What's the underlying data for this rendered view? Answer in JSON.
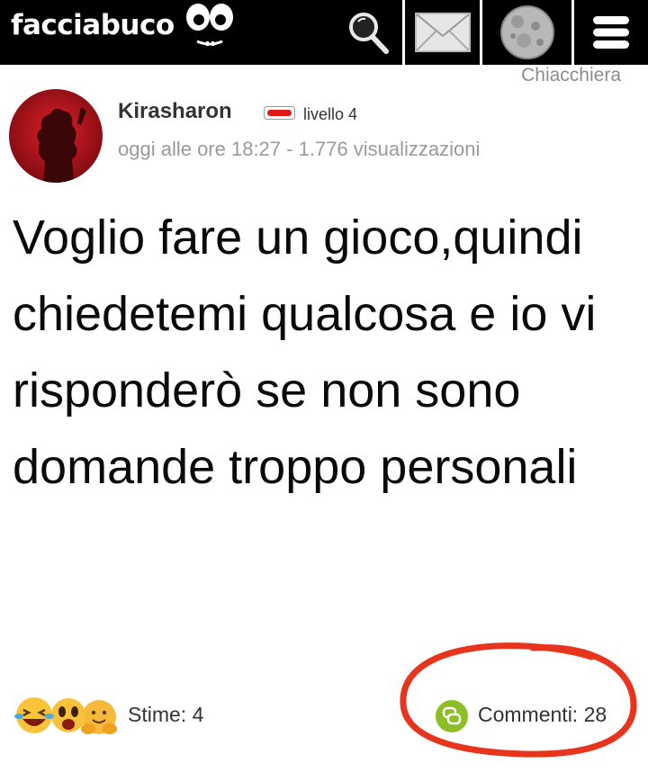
{
  "header": {
    "logo_text": "facciabuco",
    "nav": [
      {
        "name": "search",
        "icon": "search-icon"
      },
      {
        "name": "messages",
        "icon": "envelope-icon"
      },
      {
        "name": "profile",
        "icon": "moon-avatar-icon"
      },
      {
        "name": "menu",
        "icon": "hamburger-menu-icon"
      }
    ]
  },
  "section_tag": "Chiacchiera",
  "post": {
    "username": "Kirasharon",
    "level": "livello 4",
    "meta": "oggi alle ore 18:27 - 1.776 visualizzazioni",
    "body": "Voglio fare un gioco,quindi chiedetemi qualcosa e io vi risponderò se non sono domande troppo personali"
  },
  "footer": {
    "reactions": [
      "laughing-emoji",
      "surprised-emoji",
      "hugging-emoji"
    ],
    "stime_label": "Stime: 4",
    "comments_label": "Commenti: 28"
  },
  "colors": {
    "topbar": "#000000",
    "meta_text": "#9a9a9a",
    "comment_icon": "#8cbf26",
    "annotation_circle": "#e8341c",
    "avatar_bg": "#c0101a"
  }
}
